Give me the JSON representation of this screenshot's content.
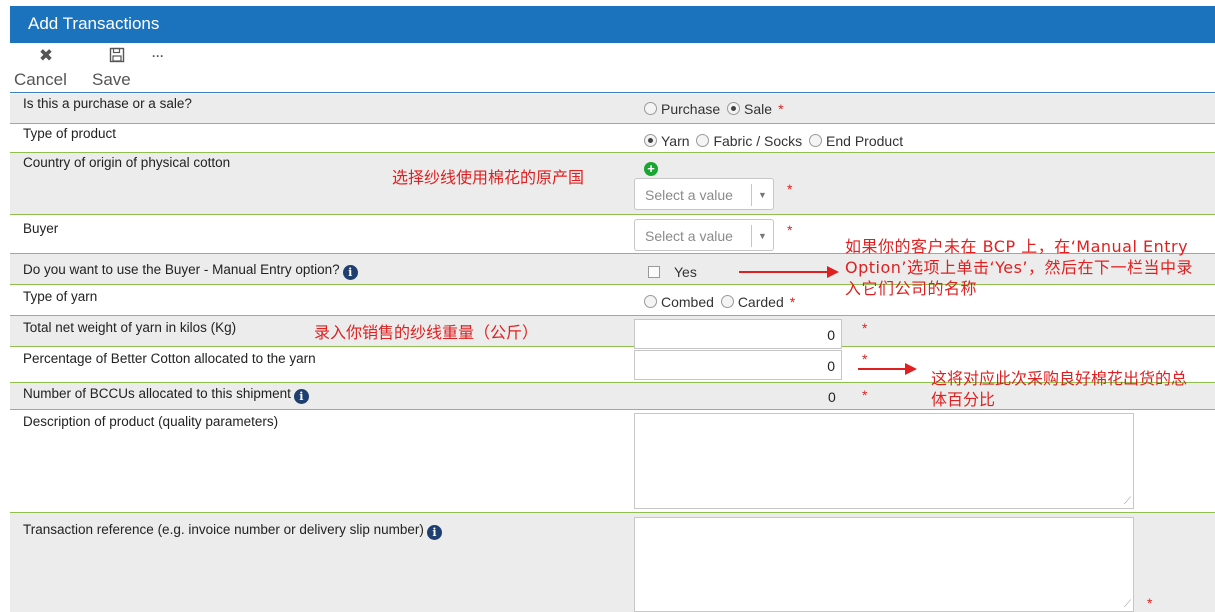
{
  "window": {
    "title": "Add Transactions"
  },
  "toolbar": {
    "cancel_label": "Cancel",
    "save_label": "Save",
    "more_label": "···"
  },
  "form": {
    "purchase_or_sale": {
      "label": "Is this a purchase or a sale?",
      "options": [
        "Purchase",
        "Sale"
      ],
      "selected": "Sale",
      "required": "*"
    },
    "product_type": {
      "label": "Type of product",
      "options": [
        "Yarn",
        "Fabric / Socks",
        "End Product"
      ],
      "selected": "Yarn"
    },
    "country_of_origin": {
      "label": "Country of origin of physical cotton",
      "placeholder": "Select a value",
      "required": "*"
    },
    "buyer": {
      "label": "Buyer",
      "placeholder": "Select a value",
      "required": "*"
    },
    "manual_entry": {
      "label": "Do you want to use the Buyer - Manual Entry option?",
      "checkbox_label": "Yes"
    },
    "yarn_type": {
      "label": "Type of yarn",
      "options": [
        "Combed",
        "Carded"
      ],
      "required": "*"
    },
    "net_weight": {
      "label": "Total net weight of yarn in kilos (Kg)",
      "value": "0",
      "required": "*"
    },
    "better_cotton_pct": {
      "label": "Percentage of Better Cotton allocated to the yarn",
      "value": "0",
      "required": "*"
    },
    "bccu_count": {
      "label": "Number of BCCUs allocated to this shipment",
      "value": "0",
      "required": "*"
    },
    "description": {
      "label": "Description of product (quality parameters)",
      "value": ""
    },
    "transaction_reference": {
      "label": "Transaction reference (e.g. invoice number or delivery slip number)",
      "value": "",
      "required": "*"
    }
  },
  "annotations": {
    "country_note": "选择纱线使用棉花的原产国",
    "buyer_note": "如果你的客户未在 BCP 上，在‘Manual Entry Option’选项上单击‘Yes’，然后在下一栏当中录入它们公司的名称",
    "weight_note": "录入你销售的纱线重量（公斤）",
    "percentage_note": "这将对应此次采购良好棉花出货的总体百分比"
  },
  "colors": {
    "header": "#1b73be",
    "row_divider": "#8fbf4f",
    "annotation": "#e02020",
    "required": "#e02020"
  },
  "icons": {
    "cancel": "close-icon",
    "save": "floppy-disk-icon",
    "more": "ellipsis-icon",
    "info": "info-circle-icon",
    "add": "plus-circle-icon"
  }
}
